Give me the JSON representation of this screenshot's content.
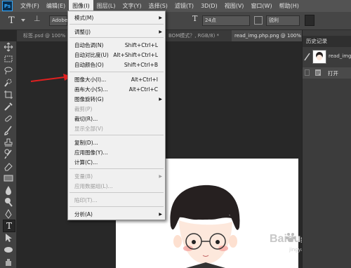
{
  "menubar": {
    "logo": "Ps",
    "items": [
      "文件(F)",
      "编辑(E)",
      "图像(I)",
      "图层(L)",
      "文字(Y)",
      "选择(S)",
      "滤镜(T)",
      "3D(D)",
      "视图(V)",
      "窗口(W)",
      "帮助(H)"
    ]
  },
  "options": {
    "tool_letter": "T",
    "font_family": "Adobe",
    "font_size": "24点",
    "antialias": "锐利",
    "size_icon_letter": "T"
  },
  "tabs": [
    "标签.psd @ 100%",
    "BOM模式？, RGB/8) *",
    "read_img.php.png @ 100%"
  ],
  "image_menu": {
    "items": [
      {
        "label": "模式(M)",
        "shortcut": "",
        "submenu": true,
        "disabled": false
      },
      {
        "label": "调整(J)",
        "shortcut": "",
        "submenu": true,
        "disabled": false
      },
      {
        "label": "自动色调(N)",
        "shortcut": "Shift+Ctrl+L",
        "submenu": false,
        "disabled": false
      },
      {
        "label": "自动对比度(U)",
        "shortcut": "Alt+Shift+Ctrl+L",
        "submenu": false,
        "disabled": false
      },
      {
        "label": "自动颜色(O)",
        "shortcut": "Shift+Ctrl+B",
        "submenu": false,
        "disabled": false
      },
      {
        "label": "图像大小(I)...",
        "shortcut": "Alt+Ctrl+I",
        "submenu": false,
        "disabled": false
      },
      {
        "label": "画布大小(S)...",
        "shortcut": "Alt+Ctrl+C",
        "submenu": false,
        "disabled": false
      },
      {
        "label": "图像旋转(G)",
        "shortcut": "",
        "submenu": true,
        "disabled": false
      },
      {
        "label": "裁剪(P)",
        "shortcut": "",
        "submenu": false,
        "disabled": true
      },
      {
        "label": "裁切(R)...",
        "shortcut": "",
        "submenu": false,
        "disabled": false
      },
      {
        "label": "显示全部(V)",
        "shortcut": "",
        "submenu": false,
        "disabled": true
      },
      {
        "label": "复制(D)...",
        "shortcut": "",
        "submenu": false,
        "disabled": false
      },
      {
        "label": "应用图像(Y)...",
        "shortcut": "",
        "submenu": false,
        "disabled": false
      },
      {
        "label": "计算(C)...",
        "shortcut": "",
        "submenu": false,
        "disabled": false
      },
      {
        "label": "变量(B)",
        "shortcut": "",
        "submenu": true,
        "disabled": true
      },
      {
        "label": "应用数据组(L)...",
        "shortcut": "",
        "submenu": false,
        "disabled": true
      },
      {
        "label": "陷印(T)...",
        "shortcut": "",
        "submenu": false,
        "disabled": true
      },
      {
        "label": "分析(A)",
        "shortcut": "",
        "submenu": true,
        "disabled": false
      }
    ]
  },
  "history_panel": {
    "title": "历史记录",
    "snapshot_label": "read_img",
    "step_label": "打开"
  },
  "watermark": {
    "brand": "Baidu",
    "suffix": "经验",
    "url": "jingyan.baidu.com"
  },
  "colors": {
    "menubar": "#535353",
    "dropdown": "#f0f0f0",
    "arrow": "#e02020",
    "ps_blue": "#31a8ff"
  },
  "icons": [
    "move-icon",
    "marquee-icon",
    "lasso-icon",
    "quick-select-icon",
    "crop-icon",
    "eyedropper-icon",
    "healing-icon",
    "brush-icon",
    "stamp-icon",
    "history-brush-icon",
    "eraser-icon",
    "gradient-icon",
    "blur-icon",
    "dodge-icon",
    "pen-icon",
    "type-icon",
    "path-select-icon",
    "ellipse-icon",
    "hand-icon"
  ]
}
